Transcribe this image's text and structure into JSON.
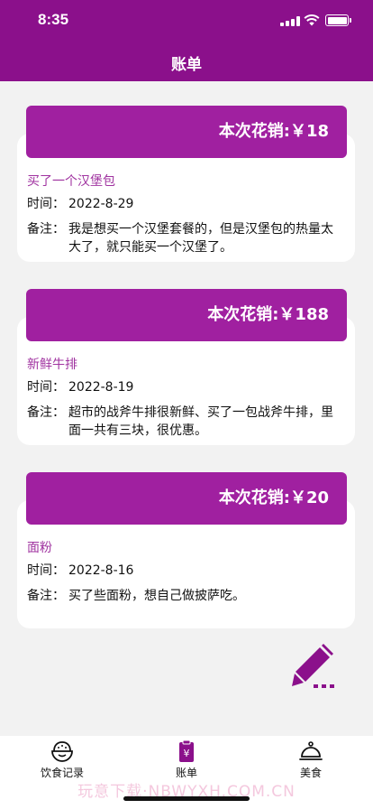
{
  "status_bar": {
    "time": "8:35"
  },
  "header": {
    "title": "账单"
  },
  "records": [
    {
      "amount_label": "本次花销:￥18",
      "name": "买了一个汉堡包",
      "time_key": "时间：",
      "time": "2022-8-29",
      "note_key": "备注：",
      "note": "我是想买一个汉堡套餐的，但是汉堡包的热量太大了，就只能买一个汉堡了。"
    },
    {
      "amount_label": "本次花销:￥188",
      "name": "新鲜牛排",
      "time_key": "时间：",
      "time": "2022-8-19",
      "note_key": "备注：",
      "note": "超市的战斧牛排很新鲜、买了一包战斧牛排，里面一共有三块，很优惠。"
    },
    {
      "amount_label": "本次花销:￥20",
      "name": "面粉",
      "time_key": "时间：",
      "time": "2022-8-16",
      "note_key": "备注：",
      "note": "买了些面粉，想自己做披萨吃。"
    }
  ],
  "fab": {
    "icon": "edit-icon"
  },
  "tabbar": {
    "tabs": [
      {
        "label": "饮食记录",
        "icon": "food-bowl-icon"
      },
      {
        "label": "账单",
        "icon": "bill-icon",
        "active": true
      },
      {
        "label": "美食",
        "icon": "cloche-icon"
      }
    ]
  },
  "watermark": "玩意下载·NBWYXH.COM.CN",
  "colors": {
    "brand": "#8b108b",
    "card_head": "#a020a0",
    "item_name": "#a033a0"
  }
}
